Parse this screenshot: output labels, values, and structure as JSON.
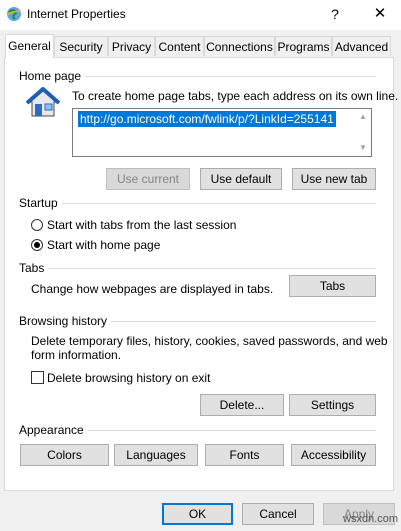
{
  "window": {
    "title": "Internet Properties",
    "help_glyph": "?",
    "close_glyph": "✕"
  },
  "tabs": [
    {
      "label": "General"
    },
    {
      "label": "Security"
    },
    {
      "label": "Privacy"
    },
    {
      "label": "Content"
    },
    {
      "label": "Connections"
    },
    {
      "label": "Programs"
    },
    {
      "label": "Advanced"
    }
  ],
  "home_page": {
    "group_label": "Home page",
    "instructions": "To create home page tabs, type each address on its own line.",
    "url": "http://go.microsoft.com/fwlink/p/?LinkId=255141",
    "use_current_label": "Use current",
    "use_default_label": "Use default",
    "use_new_tab_label": "Use new tab"
  },
  "startup": {
    "group_label": "Startup",
    "option_last_session": "Start with tabs from the last session",
    "option_home_page": "Start with home page"
  },
  "tabs_section": {
    "group_label": "Tabs",
    "description": "Change how webpages are displayed in tabs.",
    "tabs_button_label": "Tabs"
  },
  "browsing_history": {
    "group_label": "Browsing history",
    "description_line1": "Delete temporary files, history, cookies, saved passwords, and web",
    "description_line2": "form information.",
    "delete_on_exit_label": "Delete browsing history on exit",
    "delete_button_label": "Delete...",
    "settings_button_label": "Settings"
  },
  "appearance": {
    "group_label": "Appearance",
    "colors_label": "Colors",
    "languages_label": "Languages",
    "fonts_label": "Fonts",
    "accessibility_label": "Accessibility"
  },
  "footer": {
    "ok_label": "OK",
    "cancel_label": "Cancel",
    "apply_label": "Apply",
    "watermark": "wsxdn.com"
  },
  "colors": {
    "accent": "#0078d7",
    "selection_text": "#ffffff",
    "disabled_text": "#838383"
  }
}
